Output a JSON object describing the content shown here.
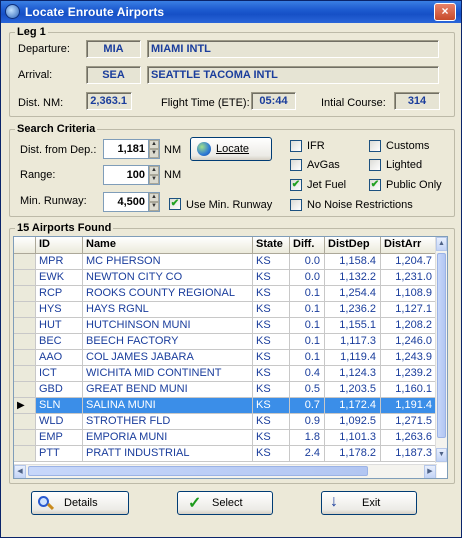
{
  "window": {
    "title": "Locate Enroute Airports",
    "close_label": "×"
  },
  "leg": {
    "group_label": "Leg 1",
    "departure_label": "Departure:",
    "departure_code": "MIA",
    "departure_name": "MIAMI INTL",
    "arrival_label": "Arrival:",
    "arrival_code": "SEA",
    "arrival_name": "SEATTLE TACOMA INTL",
    "dist_label": "Dist. NM:",
    "dist_value": "2,363.1",
    "ete_label": "Flight Time (ETE):",
    "ete_value": "05:44",
    "course_label": "Intial Course:",
    "course_value": "314"
  },
  "search": {
    "group_label": "Search Criteria",
    "dist_label": "Dist. from Dep.:",
    "dist_value": "1,181",
    "dist_unit": "NM",
    "range_label": "Range:",
    "range_value": "100",
    "range_unit": "NM",
    "runway_label": "Min. Runway:",
    "runway_value": "4,500",
    "use_min_runway_label": "Use Min. Runway",
    "use_min_runway_checked": true,
    "locate_label": "Locate",
    "options": {
      "ifr": {
        "label": "IFR",
        "checked": false
      },
      "customs": {
        "label": "Customs",
        "checked": false
      },
      "avgas": {
        "label": "AvGas",
        "checked": false
      },
      "lighted": {
        "label": "Lighted",
        "checked": false
      },
      "jetfuel": {
        "label": "Jet Fuel",
        "checked": true
      },
      "public_only": {
        "label": "Public Only",
        "checked": true
      },
      "no_noise": {
        "label": "No Noise Restrictions",
        "checked": false
      }
    }
  },
  "results": {
    "group_label": "15 Airports Found",
    "columns": [
      "ID",
      "Name",
      "State",
      "Diff.",
      "DistDep",
      "DistArr"
    ],
    "rows": [
      [
        "MPR",
        "MC PHERSON",
        "KS",
        "0.0",
        "1,158.4",
        "1,204.7"
      ],
      [
        "EWK",
        "NEWTON CITY CO",
        "KS",
        "0.0",
        "1,132.2",
        "1,231.0"
      ],
      [
        "RCP",
        "ROOKS COUNTY REGIONAL",
        "KS",
        "0.1",
        "1,254.4",
        "1,108.9"
      ],
      [
        "HYS",
        "HAYS RGNL",
        "KS",
        "0.1",
        "1,236.2",
        "1,127.1"
      ],
      [
        "HUT",
        "HUTCHINSON MUNI",
        "KS",
        "0.1",
        "1,155.1",
        "1,208.2"
      ],
      [
        "BEC",
        "BEECH FACTORY",
        "KS",
        "0.1",
        "1,117.3",
        "1,246.0"
      ],
      [
        "AAO",
        "COL JAMES JABARA",
        "KS",
        "0.1",
        "1,119.4",
        "1,243.9"
      ],
      [
        "ICT",
        "WICHITA MID CONTINENT",
        "KS",
        "0.4",
        "1,124.3",
        "1,239.2"
      ],
      [
        "GBD",
        "GREAT BEND MUNI",
        "KS",
        "0.5",
        "1,203.5",
        "1,160.1"
      ],
      [
        "SLN",
        "SALINA MUNI",
        "KS",
        "0.7",
        "1,172.4",
        "1,191.4"
      ],
      [
        "WLD",
        "STROTHER FLD",
        "KS",
        "0.9",
        "1,092.5",
        "1,271.5"
      ],
      [
        "EMP",
        "EMPORIA MUNI",
        "KS",
        "1.8",
        "1,101.3",
        "1,263.6"
      ],
      [
        "PTT",
        "PRATT INDUSTRIAL",
        "KS",
        "2.4",
        "1,178.2",
        "1,187.3"
      ]
    ],
    "selected_index": 9
  },
  "buttons": {
    "details": "Details",
    "select": "Select",
    "exit": "Exit"
  },
  "colors": {
    "accent": "#1a3d9c",
    "selection": "#3b8ee8",
    "titlebar": "#1d5bd0"
  }
}
